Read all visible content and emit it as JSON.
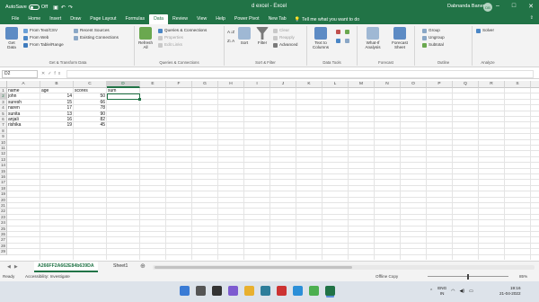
{
  "titlebar": {
    "autosave_label": "AutoSave",
    "autosave_state": "Off",
    "document_title": "d excel - Excel",
    "user_name": "Dabnanda Banerjee",
    "avatar_initials": "DB",
    "accent_color": "#217346"
  },
  "tabs": [
    {
      "label": "File"
    },
    {
      "label": "Home"
    },
    {
      "label": "Insert"
    },
    {
      "label": "Draw"
    },
    {
      "label": "Page Layout"
    },
    {
      "label": "Formulas"
    },
    {
      "label": "Data",
      "active": true
    },
    {
      "label": "Review"
    },
    {
      "label": "View"
    },
    {
      "label": "Help"
    },
    {
      "label": "Power Pivot"
    },
    {
      "label": "New Tab"
    }
  ],
  "tell_me": "Tell me what you want to do",
  "ribbon": {
    "get_data": "Get Data",
    "from_text_csv": "From Text/CSV",
    "from_web": "From Web",
    "from_table_range": "From Table/Range",
    "recent_sources": "Recent Sources",
    "existing_connections": "Existing Connections",
    "group_get_transform": "Get & Transform Data",
    "refresh_all": "Refresh All",
    "queries_connections": "Queries & Connections",
    "properties": "Properties",
    "edit_links": "Edit Links",
    "group_queries": "Queries & Connections",
    "sort_az": "A↓Z",
    "sort_za": "Z↓A",
    "sort": "Sort",
    "filter": "Filter",
    "clear": "Clear",
    "reapply": "Reapply",
    "advanced": "Advanced",
    "group_sort_filter": "Sort & Filter",
    "text_to_columns": "Text to Columns",
    "group_data_tools": "Data Tools",
    "what_if": "What-If Analysis",
    "forecast_sheet": "Forecast Sheet",
    "group_forecast": "Forecast",
    "group_btn": "Group",
    "ungroup_btn": "Ungroup",
    "subtotal_btn": "Subtotal",
    "group_outline": "Outline",
    "solver": "Solver",
    "group_analyze": "Analyze"
  },
  "formula_bar": {
    "name_box": "D2",
    "fx": "fx",
    "content": ""
  },
  "grid": {
    "columns": [
      "A",
      "B",
      "C",
      "D",
      "E",
      "F",
      "G",
      "H",
      "I",
      "J",
      "K",
      "L",
      "M",
      "N",
      "O",
      "P",
      "Q",
      "R",
      "S",
      "T"
    ],
    "selected_column": "D",
    "selected_row": 2,
    "row_count": 29,
    "rows": [
      [
        "name",
        "age",
        "scores",
        "sum"
      ],
      [
        "john",
        "14",
        "50",
        ""
      ],
      [
        "suresh",
        "15",
        "66",
        ""
      ],
      [
        "naren",
        "17",
        "78",
        ""
      ],
      [
        "sunita",
        "13",
        "90",
        ""
      ],
      [
        "anjali",
        "16",
        "82",
        ""
      ],
      [
        "rishika",
        "19",
        "45",
        ""
      ]
    ]
  },
  "sheets": [
    {
      "label": "A266FF2A662E84b639DA",
      "active": true
    },
    {
      "label": "Sheet1",
      "active": false
    }
  ],
  "statusbar": {
    "ready": "Ready",
    "accessibility": "Accessibility: Investigate",
    "offline": "Offline Copy",
    "zoom": "85%"
  },
  "taskbar": {
    "lang_1": "ENG",
    "lang_2": "IN",
    "time": "19:16",
    "date": "21-04-2022"
  }
}
